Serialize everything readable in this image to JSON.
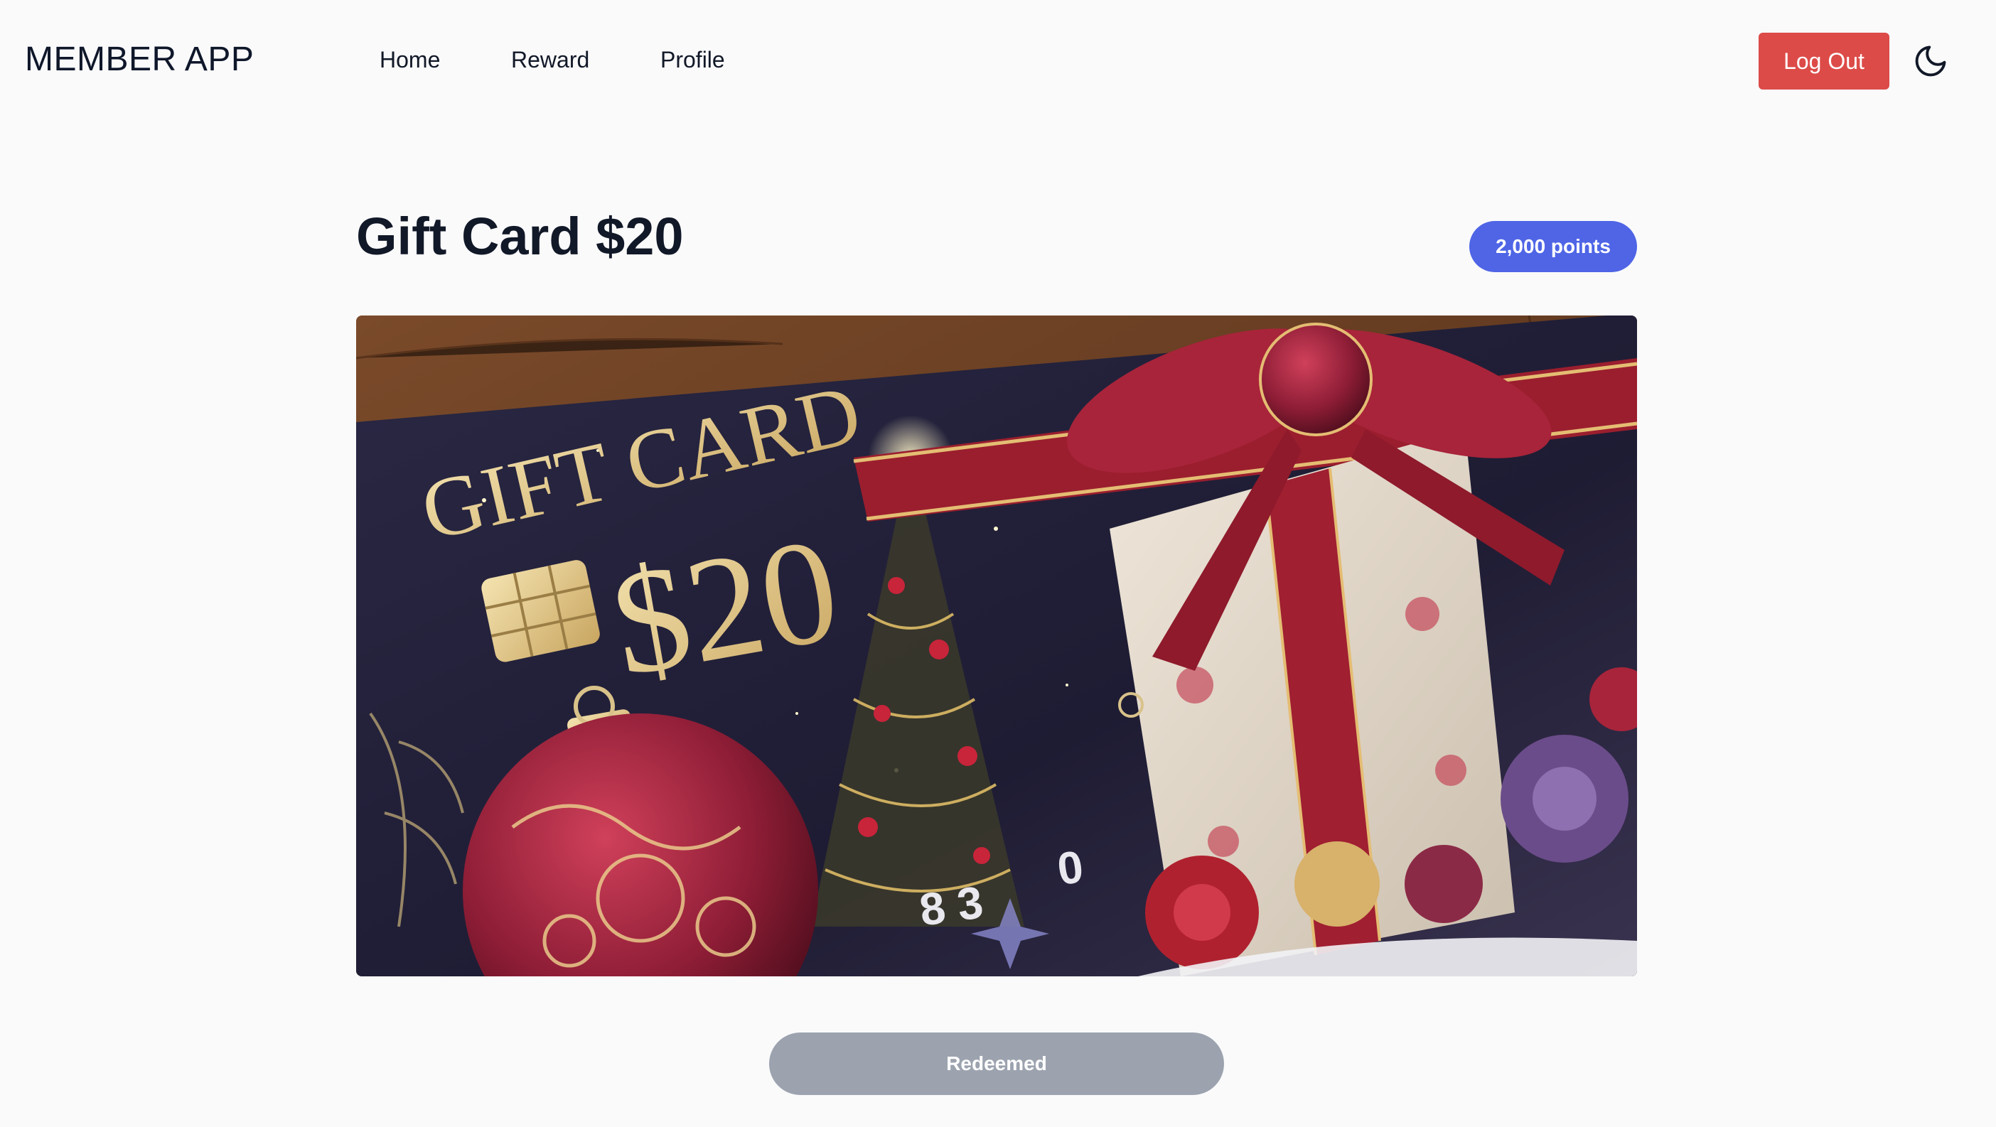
{
  "app": {
    "brand": "MEMBER APP"
  },
  "nav": {
    "items": [
      {
        "label": "Home"
      },
      {
        "label": "Reward"
      },
      {
        "label": "Profile"
      }
    ],
    "logout_label": "Log Out",
    "theme_icon": "moon-icon"
  },
  "reward": {
    "title": "Gift Card $20",
    "points_badge": "2,000 points",
    "image": {
      "subject": "gift-card-illustration",
      "card_heading": "GIFT CARD",
      "card_amount": "$20"
    },
    "action_label": "Redeemed",
    "action_state": "disabled"
  },
  "colors": {
    "logout": "#dc4b48",
    "badge": "#4f65e6",
    "disabled_button": "#9ca3af",
    "page_bg": "#fafafb"
  }
}
